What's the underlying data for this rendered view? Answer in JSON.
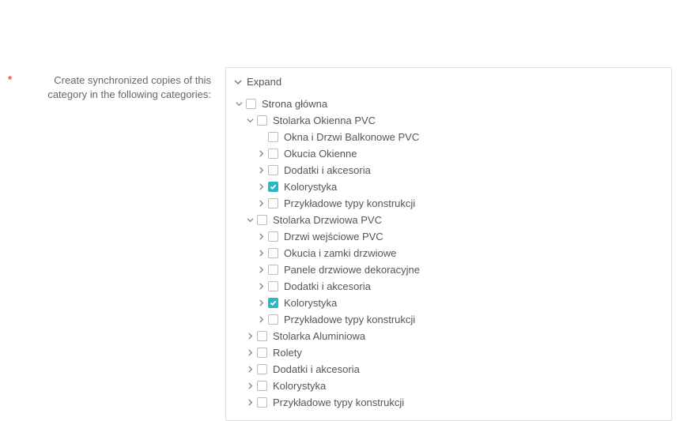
{
  "label": {
    "required": "*",
    "text": "Create synchronized copies of this category in the following categories:"
  },
  "expand": {
    "text": "Expand"
  },
  "tree": [
    {
      "label": "Strona główna",
      "checked": false,
      "expanded": true,
      "children": [
        {
          "label": "Stolarka Okienna PVC",
          "checked": false,
          "expanded": true,
          "children": [
            {
              "label": "Okna i Drzwi Balkonowe PVC",
              "checked": false,
              "hasChildren": false
            },
            {
              "label": "Okucia Okienne",
              "checked": false,
              "hasChildren": true
            },
            {
              "label": "Dodatki i akcesoria",
              "checked": false,
              "hasChildren": true
            },
            {
              "label": "Kolorystyka",
              "checked": true,
              "hasChildren": true
            },
            {
              "label": "Przykładowe typy konstrukcji",
              "checked": false,
              "hasChildren": true
            }
          ]
        },
        {
          "label": "Stolarka Drzwiowa PVC",
          "checked": false,
          "expanded": true,
          "children": [
            {
              "label": "Drzwi wejściowe PVC",
              "checked": false,
              "hasChildren": true
            },
            {
              "label": "Okucia i zamki drzwiowe",
              "checked": false,
              "hasChildren": true
            },
            {
              "label": "Panele drzwiowe dekoracyjne",
              "checked": false,
              "hasChildren": true
            },
            {
              "label": "Dodatki i akcesoria",
              "checked": false,
              "hasChildren": true
            },
            {
              "label": "Kolorystyka",
              "checked": true,
              "hasChildren": true
            },
            {
              "label": "Przykładowe typy konstrukcji",
              "checked": false,
              "hasChildren": true
            }
          ]
        },
        {
          "label": "Stolarka Aluminiowa",
          "checked": false,
          "hasChildren": true
        },
        {
          "label": "Rolety",
          "checked": false,
          "hasChildren": true
        },
        {
          "label": "Dodatki i akcesoria",
          "checked": false,
          "hasChildren": true
        },
        {
          "label": "Kolorystyka",
          "checked": false,
          "hasChildren": true
        },
        {
          "label": "Przykładowe typy konstrukcji",
          "checked": false,
          "hasChildren": true
        }
      ]
    }
  ]
}
